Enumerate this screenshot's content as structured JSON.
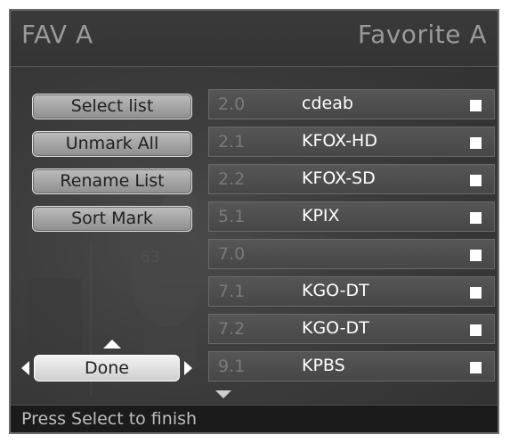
{
  "header": {
    "title_left": "FAV A",
    "title_right": "Favorite A"
  },
  "actions": {
    "select_list": "Select list",
    "unmark_all": "Unmark All",
    "rename_list": "Rename List",
    "sort_mark": "Sort Mark",
    "done": "Done"
  },
  "channels": [
    {
      "number": "2.0",
      "name": "cdeab",
      "checked": true
    },
    {
      "number": "2.1",
      "name": "KFOX-HD",
      "checked": true
    },
    {
      "number": "2.2",
      "name": "KFOX-SD",
      "checked": true
    },
    {
      "number": "5.1",
      "name": "KPIX",
      "checked": true
    },
    {
      "number": "7.0",
      "name": "",
      "checked": true
    },
    {
      "number": "7.1",
      "name": "KGO-DT",
      "checked": true
    },
    {
      "number": "7.2",
      "name": "KGO-DT",
      "checked": true
    },
    {
      "number": "9.1",
      "name": "KPBS",
      "checked": true
    }
  ],
  "status": {
    "text": "Press Select to finish"
  }
}
